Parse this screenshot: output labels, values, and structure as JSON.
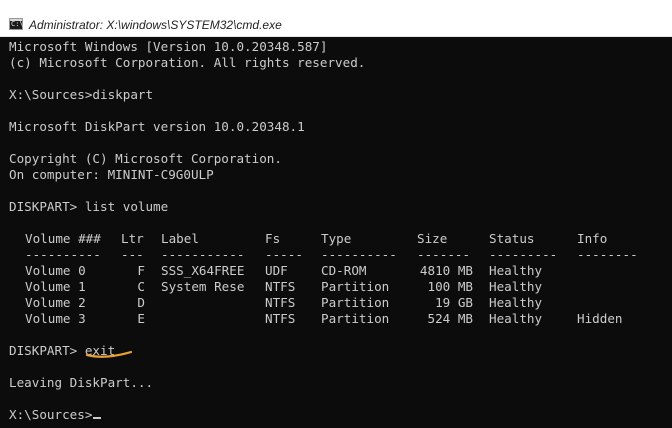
{
  "window": {
    "title": "Administrator: X:\\windows\\SYSTEM32\\cmd.exe",
    "icon_name": "cmd-icon",
    "icon_glyph": "C:\\"
  },
  "console": {
    "header": [
      "Microsoft Windows [Version 10.0.20348.587]",
      "(c) Microsoft Corporation. All rights reserved."
    ],
    "prompt1": "X:\\Sources>diskpart",
    "version": "Microsoft DiskPart version 10.0.20348.1",
    "copyright": "Copyright (C) Microsoft Corporation.",
    "computer": "On computer: MININT-C9G0ULP",
    "cmd_list": "DISKPART> list volume",
    "table": {
      "headers": [
        "Volume ###",
        "Ltr",
        "Label",
        "Fs",
        "Type",
        "Size",
        "Status",
        "Info"
      ],
      "separators": [
        "----------",
        "---",
        "-----------",
        "-----",
        "----------",
        "-------",
        "---------",
        "--------"
      ],
      "rows": [
        [
          "Volume 0",
          "F",
          "SSS_X64FREE",
          "UDF",
          "CD-ROM",
          "4810 MB",
          "Healthy",
          ""
        ],
        [
          "Volume 1",
          "C",
          "System Rese",
          "NTFS",
          "Partition",
          "100 MB",
          "Healthy",
          ""
        ],
        [
          "Volume 2",
          "D",
          "",
          "NTFS",
          "Partition",
          "19 GB",
          "Healthy",
          ""
        ],
        [
          "Volume 3",
          "E",
          "",
          "NTFS",
          "Partition",
          "524 MB",
          "Healthy",
          "Hidden"
        ]
      ]
    },
    "exit_prompt": "DISKPART> ",
    "exit_cmd": "exit",
    "leaving": "Leaving DiskPart...",
    "final_prompt": "X:\\Sources>"
  },
  "colors": {
    "background": "#0c0c0c",
    "text": "#cccccc",
    "titlebar": "#ffffff",
    "annotation": "#e8a233"
  }
}
